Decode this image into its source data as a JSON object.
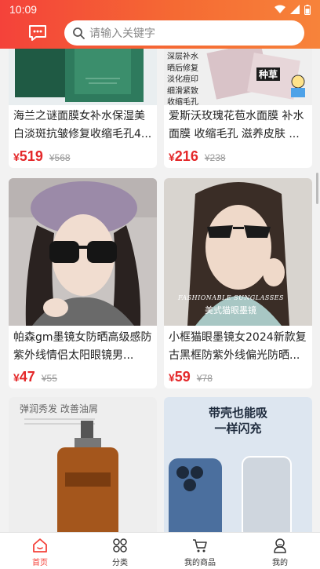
{
  "status_bar": {
    "time": "10:09"
  },
  "search": {
    "placeholder": "请输入关键字"
  },
  "products": [
    {
      "title": "海兰之谜面膜女补水保湿美白淡斑抗皱修复收缩毛孔4...",
      "price": "519",
      "original_price": "568",
      "image_text": []
    },
    {
      "title": "爱斯沃玫瑰花苞水面膜 补水面膜 收缩毛孔 滋养皮肤 ...",
      "price": "216",
      "original_price": "238",
      "image_text": [
        "深层补水",
        "晒后修复",
        "淡化痘印",
        "细滑紧致",
        "收缩毛孔",
        "种草"
      ]
    },
    {
      "title": "帕森gm墨镜女防晒高级感防紫外线情侣太阳眼镜男...",
      "price": "47",
      "original_price": "55",
      "image_text": []
    },
    {
      "title": "小框猫眼墨镜女2024新款复古黑框防紫外线偏光防晒...",
      "price": "59",
      "original_price": "78",
      "image_text": [
        "FASHIONABLE SUNGLASSES",
        "美式猫眼墨镜"
      ]
    },
    {
      "title": "",
      "price": "",
      "original_price": "",
      "image_text": [
        "弹润秀发 改善油屑"
      ]
    },
    {
      "title": "",
      "price": "",
      "original_price": "",
      "image_text": [
        "带壳也能吸",
        "一样闪充"
      ]
    }
  ],
  "currency_symbol": "¥",
  "tabs": [
    {
      "label": "首页",
      "icon": "home-icon",
      "active": true
    },
    {
      "label": "分类",
      "icon": "grid-icon",
      "active": false
    },
    {
      "label": "我的商品",
      "icon": "cart-icon",
      "active": false
    },
    {
      "label": "我的",
      "icon": "user-icon",
      "active": false
    }
  ],
  "colors": {
    "accent": "#f4423a",
    "price": "#e4282a",
    "header_end": "#f7833a"
  }
}
